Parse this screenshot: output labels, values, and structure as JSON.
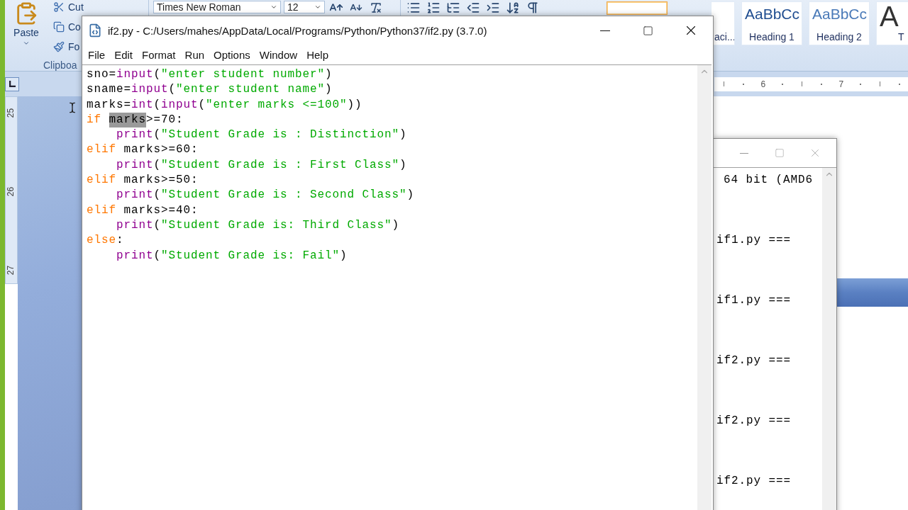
{
  "word": {
    "clipboard": {
      "paste": "Paste",
      "commands": [
        {
          "kind": "cut",
          "label": "Cut"
        },
        {
          "kind": "copy",
          "label": "Co"
        },
        {
          "kind": "painter",
          "label": "Fo"
        }
      ],
      "group_label": "Clipboa"
    },
    "font": {
      "name": "Times New Roman",
      "size": "12"
    },
    "styles": [
      {
        "selected": true
      },
      {
        "label": "aci...",
        "selected": false
      },
      {
        "preview": "AaBbCc",
        "label": "Heading 1",
        "selected": false,
        "kind": "heading"
      },
      {
        "preview": "AaBbCc",
        "label": "Heading 2",
        "selected": false,
        "kind": "heading2"
      },
      {
        "preview": "A",
        "label": "T",
        "selected": false,
        "kind": "title"
      }
    ],
    "ruler_numbers": [
      "6",
      "7"
    ],
    "vertical_ruler_numbers": [
      "25",
      "26",
      "27"
    ]
  },
  "editor": {
    "title": "if2.py - C:/Users/mahes/AppData/Local/Programs/Python/Python37/if2.py (3.7.0)",
    "menu": [
      "File",
      "Edit",
      "Format",
      "Run",
      "Options",
      "Window",
      "Help"
    ],
    "lines": [
      {
        "indented": false,
        "tokens": [
          {
            "kind": "plain",
            "text": "sno="
          },
          {
            "kind": "builtin",
            "text": "input"
          },
          {
            "kind": "plain",
            "text": "("
          },
          {
            "kind": "string",
            "text": "\"enter student number\""
          },
          {
            "kind": "plain",
            "text": ")"
          }
        ]
      },
      {
        "indented": false,
        "tokens": [
          {
            "kind": "plain",
            "text": "sname="
          },
          {
            "kind": "builtin",
            "text": "input"
          },
          {
            "kind": "plain",
            "text": "("
          },
          {
            "kind": "string",
            "text": "\"enter student name\""
          },
          {
            "kind": "plain",
            "text": ")"
          }
        ]
      },
      {
        "indented": false,
        "tokens": [
          {
            "kind": "plain",
            "text": "marks="
          },
          {
            "kind": "builtin",
            "text": "int"
          },
          {
            "kind": "plain",
            "text": "("
          },
          {
            "kind": "builtin",
            "text": "input"
          },
          {
            "kind": "plain",
            "text": "("
          },
          {
            "kind": "string",
            "text": "\"enter marks <=100\""
          },
          {
            "kind": "plain",
            "text": "))"
          }
        ]
      },
      {
        "indented": false,
        "tokens": [
          {
            "kind": "keyword",
            "text": "if "
          },
          {
            "kind": "selected",
            "text": "marks"
          },
          {
            "kind": "plain",
            "text": ">=70:"
          }
        ]
      },
      {
        "indented": true,
        "tokens": [
          {
            "kind": "builtin",
            "text": "print"
          },
          {
            "kind": "plain",
            "text": "("
          },
          {
            "kind": "string",
            "text": "\"Student Grade is : Distinction\""
          },
          {
            "kind": "plain",
            "text": ")"
          }
        ]
      },
      {
        "indented": false,
        "tokens": [
          {
            "kind": "keyword",
            "text": "elif"
          },
          {
            "kind": "plain",
            "text": " marks>=60:"
          }
        ]
      },
      {
        "indented": true,
        "tokens": [
          {
            "kind": "builtin",
            "text": "print"
          },
          {
            "kind": "plain",
            "text": "("
          },
          {
            "kind": "string",
            "text": "\"Student Grade is : First Class\""
          },
          {
            "kind": "plain",
            "text": ")"
          }
        ]
      },
      {
        "indented": false,
        "tokens": [
          {
            "kind": "keyword",
            "text": "elif"
          },
          {
            "kind": "plain",
            "text": " marks>=50:"
          }
        ]
      },
      {
        "indented": true,
        "tokens": [
          {
            "kind": "builtin",
            "text": "print"
          },
          {
            "kind": "plain",
            "text": "("
          },
          {
            "kind": "string",
            "text": "\"Student Grade is : Second Class\""
          },
          {
            "kind": "plain",
            "text": ")"
          }
        ]
      },
      {
        "indented": false,
        "tokens": [
          {
            "kind": "keyword",
            "text": "elif"
          },
          {
            "kind": "plain",
            "text": " marks>=40:"
          }
        ]
      },
      {
        "indented": true,
        "tokens": [
          {
            "kind": "builtin",
            "text": "print"
          },
          {
            "kind": "plain",
            "text": "("
          },
          {
            "kind": "string",
            "text": "\"Student Grade is: Third Class\""
          },
          {
            "kind": "plain",
            "text": ")"
          }
        ]
      },
      {
        "indented": false,
        "tokens": [
          {
            "kind": "keyword",
            "text": "else"
          },
          {
            "kind": "plain",
            "text": ":"
          }
        ]
      },
      {
        "indented": true,
        "tokens": [
          {
            "kind": "builtin",
            "text": "print"
          },
          {
            "kind": "plain",
            "text": "("
          },
          {
            "kind": "string",
            "text": "\"Student Grade is: Fail\""
          },
          {
            "kind": "plain",
            "text": ")"
          }
        ]
      }
    ]
  },
  "shell": {
    "lines": [
      "64 bit (AMD6",
      "if1.py ===",
      "if1.py ===",
      "if2.py ===",
      "if2.py ===",
      "if2.py ==="
    ]
  }
}
